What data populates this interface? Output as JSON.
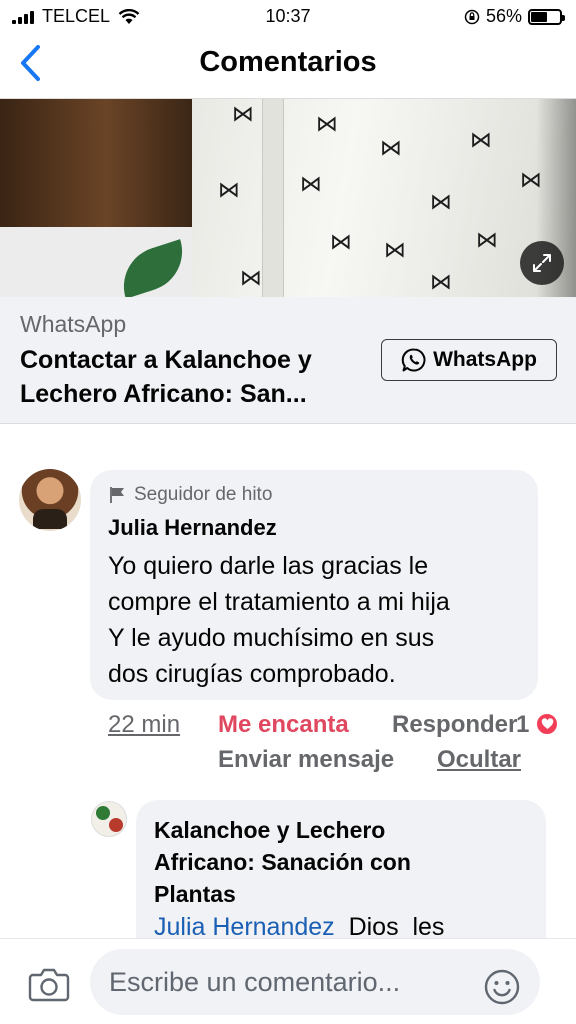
{
  "status_bar": {
    "carrier": "TELCEL",
    "time": "10:37",
    "battery": "56%",
    "battery_level": 0.56
  },
  "header": {
    "title": "Comentarios",
    "back_icon": "chevron-left-icon"
  },
  "link_preview": {
    "source": "WhatsApp",
    "title_line1": "Contactar a Kalanchoe y",
    "title_line2": "Lechero Africano: San...",
    "cta_label": "WhatsApp",
    "cta_icon": "whatsapp-icon",
    "expand_icon": "expand-icon"
  },
  "comments": [
    {
      "badge": "Seguidor de hito",
      "badge_icon": "flag-icon",
      "author": "Julia Hernandez",
      "text_lines": [
        "Yo quiero darle las gracias le",
        "compre el tratamiento a mi hija",
        "Y le ayudo muchísimo en sus",
        "dos cirugías comprobado."
      ],
      "time": "22 min",
      "reaction_label": "Me encanta",
      "reply_label": "Responder",
      "reaction_count": "1",
      "reaction_icon": "heart-icon",
      "send_message_label": "Enviar mensaje",
      "hide_label": "Ocultar"
    }
  ],
  "reply": {
    "author_lines": [
      "Kalanchoe y  Lechero",
      "Africano: Sanación con",
      "Plantas"
    ],
    "mention": "Julia Hernandez",
    "text": "  Dios  les"
  },
  "composer": {
    "placeholder": "Escribe un comentario...",
    "camera_icon": "camera-icon",
    "emoji_icon": "smiley-icon"
  },
  "colors": {
    "accent": "#1877f2",
    "love": "#e0485f",
    "bubble": "#f0f2f5",
    "secondary_text": "#65676b"
  }
}
